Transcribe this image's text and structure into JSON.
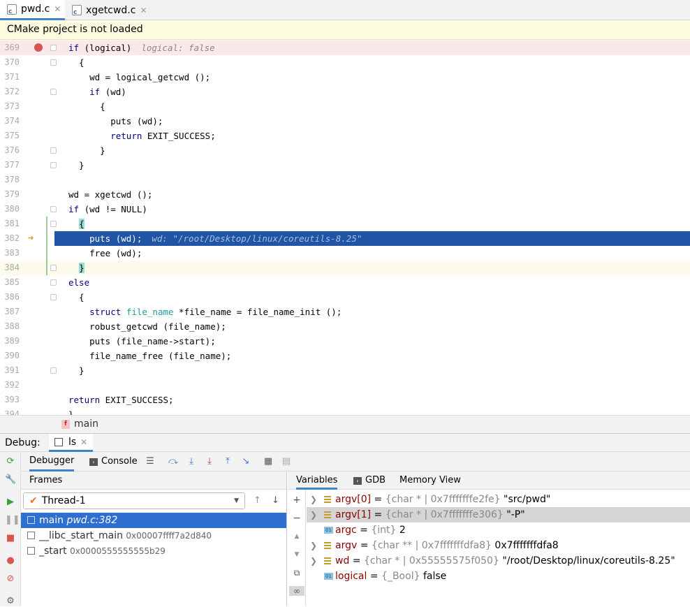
{
  "tabs": [
    {
      "label": "pwd.c",
      "active": true
    },
    {
      "label": "xgetcwd.c",
      "active": false
    }
  ],
  "banner": "CMake project is not loaded",
  "editor": {
    "lines": [
      {
        "n": "369",
        "html": "<span class='kw'>if</span> (logical)",
        "hint": "logical: false"
      },
      {
        "n": "370",
        "html": "  {"
      },
      {
        "n": "371",
        "html": "    wd = logical_getcwd ();"
      },
      {
        "n": "372",
        "html": "    <span class='kw'>if</span> (wd)"
      },
      {
        "n": "373",
        "html": "      {"
      },
      {
        "n": "374",
        "html": "        puts (wd);"
      },
      {
        "n": "375",
        "html": "        <span class='kw'>return</span> EXIT_SUCCESS;"
      },
      {
        "n": "376",
        "html": "      }"
      },
      {
        "n": "377",
        "html": "  }"
      },
      {
        "n": "378",
        "html": ""
      },
      {
        "n": "379",
        "html": "wd = xgetcwd ();"
      },
      {
        "n": "380",
        "html": "<span class='kw'>if</span> (wd != NULL)"
      },
      {
        "n": "381",
        "html": "  <span class='brace-hl'>{</span>"
      },
      {
        "n": "382",
        "html": "    puts (wd);",
        "hint": "wd: \"/root/Desktop/linux/coreutils-8.25\""
      },
      {
        "n": "383",
        "html": "    free (wd);"
      },
      {
        "n": "384",
        "html": "  <span class='brace-hl'>}</span>"
      },
      {
        "n": "385",
        "html": "<span class='kw'>else</span>"
      },
      {
        "n": "386",
        "html": "  {"
      },
      {
        "n": "387",
        "html": "    <span class='kw'>struct</span> <span class='ty'>file_name</span> *file_name = file_name_init ();"
      },
      {
        "n": "388",
        "html": "    robust_getcwd (file_name);"
      },
      {
        "n": "389",
        "html": "    puts (file_name->start);"
      },
      {
        "n": "390",
        "html": "    file_name_free (file_name);"
      },
      {
        "n": "391",
        "html": "  }"
      },
      {
        "n": "392",
        "html": ""
      },
      {
        "n": "393",
        "html": "<span class='kw'>return</span> EXIT_SUCCESS;"
      },
      {
        "n": "394",
        "html": "}"
      }
    ]
  },
  "breadcrumb": {
    "icon": "f",
    "label": "main"
  },
  "debug": {
    "label": "Debug:",
    "session": "ls",
    "tabs": {
      "debugger": "Debugger",
      "console": "Console"
    },
    "frames_header": "Frames",
    "thread": "Thread-1",
    "frames": [
      {
        "name": "main",
        "loc": "pwd.c:382",
        "addr": "",
        "selected": true
      },
      {
        "name": "__libc_start_main",
        "loc": "",
        "addr": "0x00007ffff7a2d840",
        "selected": false
      },
      {
        "name": "_start",
        "loc": "",
        "addr": "0x0000555555555b29",
        "selected": false
      }
    ],
    "var_tabs": {
      "variables": "Variables",
      "gdb": "GDB",
      "memory": "Memory View"
    },
    "variables": [
      {
        "name": "argv[0]",
        "type": "{char * | 0x7fffffffe2fe}",
        "value": "\"src/pwd\"",
        "expandable": true,
        "icon": "array",
        "selected": false
      },
      {
        "name": "argv[1]",
        "type": "{char * | 0x7fffffffe306}",
        "value": "\"-P\"",
        "expandable": true,
        "icon": "array",
        "selected": true
      },
      {
        "name": "argc",
        "type": "{int}",
        "value": "2",
        "expandable": false,
        "icon": "primitive",
        "selected": false
      },
      {
        "name": "argv",
        "type": "{char ** | 0x7fffffffdfa8}",
        "value": "0x7fffffffdfa8",
        "expandable": true,
        "icon": "array",
        "selected": false
      },
      {
        "name": "wd",
        "type": "{char * | 0x55555575f050}",
        "value": "\"/root/Desktop/linux/coreutils-8.25\"",
        "expandable": true,
        "icon": "array",
        "selected": false
      },
      {
        "name": "logical",
        "type": "{_Bool}",
        "value": "false",
        "expandable": false,
        "icon": "primitive",
        "selected": false
      }
    ]
  },
  "colors": {
    "accent": "#4083c9",
    "exec_line": "#2154a5",
    "breakpoint": "#d9534f"
  }
}
